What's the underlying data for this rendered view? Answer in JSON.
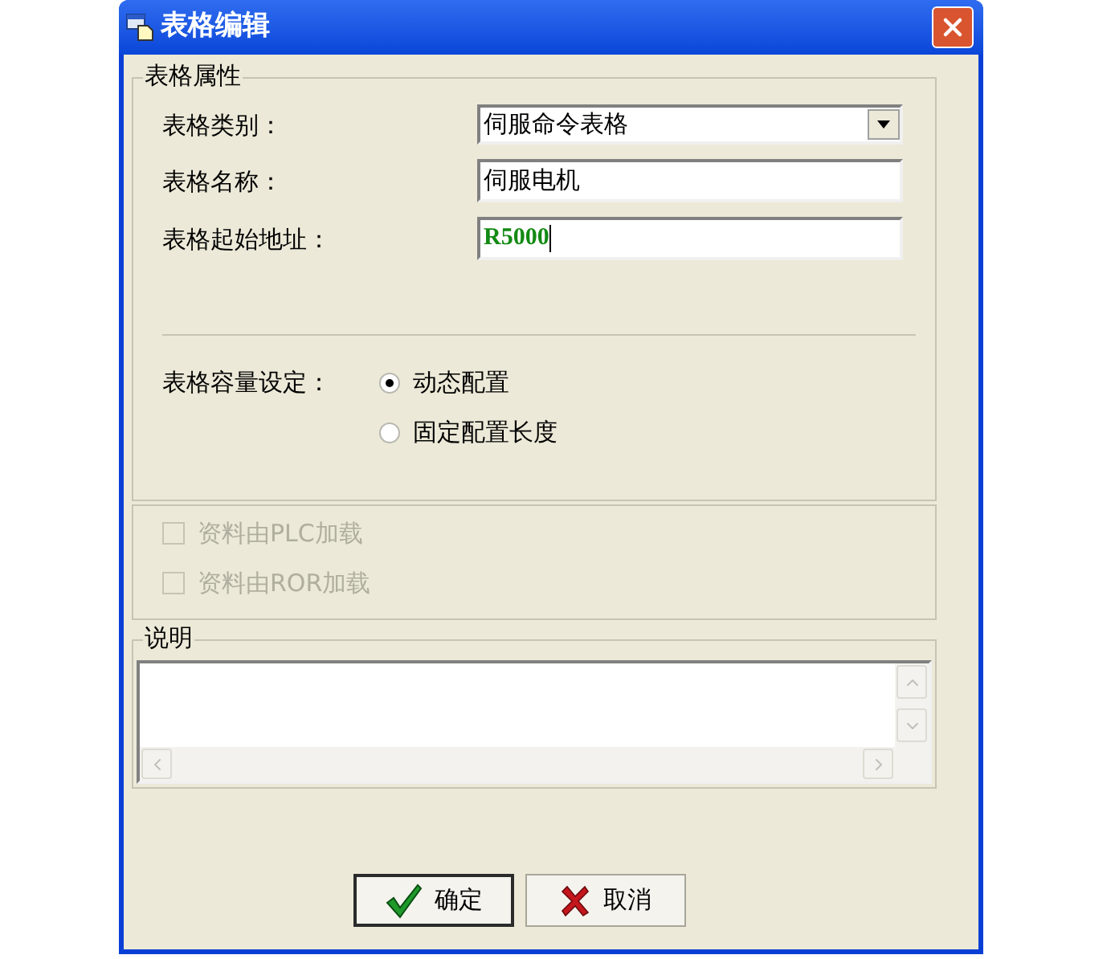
{
  "window": {
    "title": "表格编辑"
  },
  "properties": {
    "legend": "表格属性",
    "fields": [
      {
        "kind": "dropdown",
        "label": "表格类别：",
        "value": "伺服命令表格",
        "focused": false
      },
      {
        "kind": "text",
        "label": "表格名称：",
        "value": "伺服电机",
        "focused": false
      },
      {
        "kind": "text",
        "label": "表格起始地址：",
        "value": "R5000",
        "focused": true
      }
    ],
    "capacity": {
      "label": "表格容量设定：",
      "options": [
        {
          "label": "动态配置",
          "selected": true
        },
        {
          "label": "固定配置长度",
          "selected": false
        }
      ]
    }
  },
  "load_options": [
    {
      "label": "资料由PLC加载",
      "checked": false,
      "disabled": true
    },
    {
      "label": "资料由ROR加载",
      "checked": false,
      "disabled": true
    }
  ],
  "description": {
    "legend": "说明"
  },
  "buttons": [
    {
      "kind": "ok",
      "label": "确定"
    },
    {
      "kind": "cancel",
      "label": "取消"
    }
  ]
}
